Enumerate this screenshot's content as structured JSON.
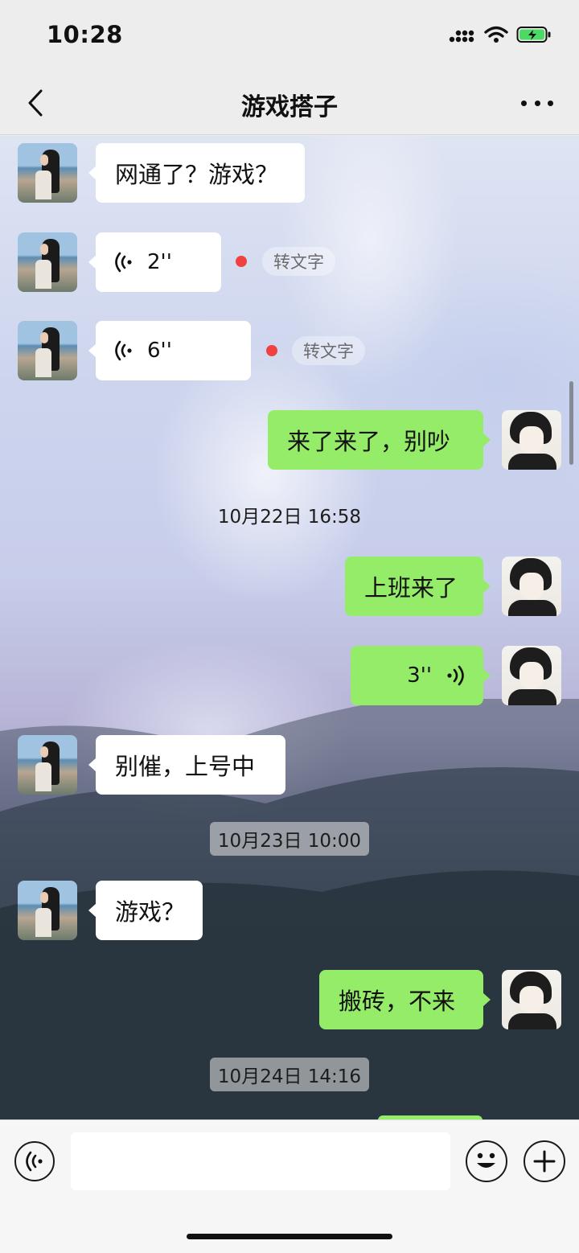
{
  "status_bar": {
    "time": "10:28"
  },
  "header": {
    "title": "游戏搭子",
    "back_icon": "chevron-left-icon",
    "more_icon": "more-dots-icon"
  },
  "messages": [
    {
      "side": "in",
      "type": "text",
      "text": "网通了？游戏？"
    },
    {
      "side": "in",
      "type": "voice",
      "duration": "2''",
      "unread": true,
      "to_text_label": "转文字"
    },
    {
      "side": "in",
      "type": "voice",
      "duration": "6''",
      "unread": true,
      "to_text_label": "转文字"
    },
    {
      "side": "out",
      "type": "text",
      "text": "来了来了，别吵"
    },
    {
      "type": "timestamp",
      "text": "10月22日 16:58"
    },
    {
      "side": "out",
      "type": "text",
      "text": "上班来了"
    },
    {
      "side": "out",
      "type": "voice",
      "duration": "3''"
    },
    {
      "side": "in",
      "type": "text",
      "text": "别催，上号中"
    },
    {
      "type": "timestamp",
      "text": "10月23日 10:00"
    },
    {
      "side": "in",
      "type": "text",
      "text": "游戏？"
    },
    {
      "side": "out",
      "type": "text",
      "text": "搬砖，不来"
    },
    {
      "type": "timestamp",
      "text": "10月24日 14:16"
    }
  ],
  "input_bar": {
    "text_value": "",
    "voice_icon": "voice-icon",
    "emoji_icon": "emoji-icon",
    "plus_icon": "plus-icon"
  },
  "colors": {
    "outgoing_bubble": "#95ec69",
    "incoming_bubble": "#ffffff",
    "unread_dot": "#f04040",
    "bar_bg": "#ededed"
  }
}
